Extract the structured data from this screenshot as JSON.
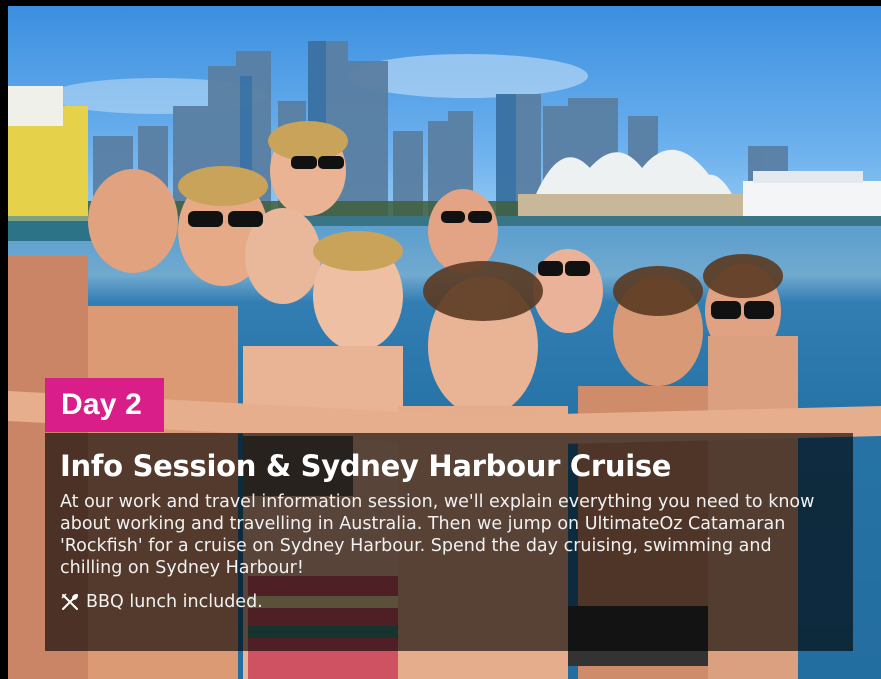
{
  "badge": {
    "label": "Day 2",
    "color": "#d91e8a"
  },
  "session": {
    "title": "Info Session & Sydney Harbour Cruise",
    "description": "At our work and travel information session, we'll explain everything you need to know about working and travelling in Australia. Then we jump on UltimateOz Catamaran 'Rockfish' for a cruise on Sydney Harbour. Spend the day cruising, swimming and chilling on Sydney Harbour!",
    "extra_icon": "cutlery-icon",
    "extra": "BBQ lunch included."
  },
  "photo": {
    "subject": "group-photo"
  }
}
